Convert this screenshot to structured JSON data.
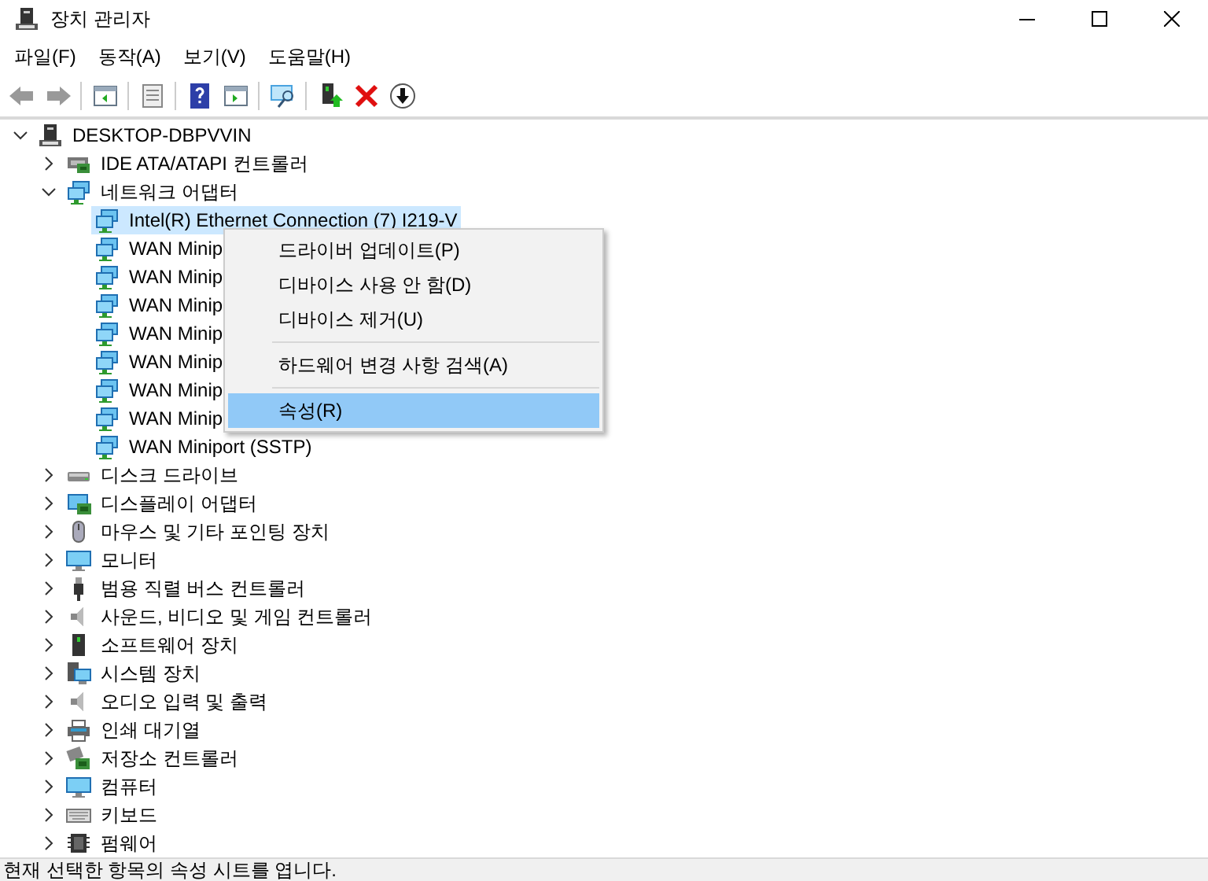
{
  "window": {
    "title": "장치 관리자"
  },
  "menu": [
    "파일(F)",
    "동작(A)",
    "보기(V)",
    "도움말(H)"
  ],
  "tree": {
    "label": "DESKTOP-DBPVVIN",
    "expanded": true,
    "selected": false,
    "children": [
      {
        "label": "IDE ATA/ATAPI 컨트롤러",
        "expanded": false,
        "selected": false
      },
      {
        "label": "네트워크 어댑터",
        "expanded": true,
        "selected": false,
        "children": [
          {
            "label": "Intel(R) Ethernet Connection (7) I219-V",
            "selected": true
          },
          {
            "label": "WAN Minip",
            "selected": false
          },
          {
            "label": "WAN Minip",
            "selected": false
          },
          {
            "label": "WAN Minip",
            "selected": false
          },
          {
            "label": "WAN Minip",
            "selected": false
          },
          {
            "label": "WAN Minip",
            "selected": false
          },
          {
            "label": "WAN Minip",
            "selected": false
          },
          {
            "label": "WAN Minip",
            "selected": false
          },
          {
            "label": "WAN Miniport (SSTP)",
            "selected": false
          }
        ]
      },
      {
        "label": "디스크 드라이브",
        "expanded": false,
        "selected": false
      },
      {
        "label": "디스플레이 어댑터",
        "expanded": false,
        "selected": false
      },
      {
        "label": "마우스 및 기타 포인팅 장치",
        "expanded": false,
        "selected": false
      },
      {
        "label": "모니터",
        "expanded": false,
        "selected": false
      },
      {
        "label": "범용 직렬 버스 컨트롤러",
        "expanded": false,
        "selected": false
      },
      {
        "label": "사운드, 비디오 및 게임 컨트롤러",
        "expanded": false,
        "selected": false
      },
      {
        "label": "소프트웨어 장치",
        "expanded": false,
        "selected": false
      },
      {
        "label": "시스템 장치",
        "expanded": false,
        "selected": false
      },
      {
        "label": "오디오 입력 및 출력",
        "expanded": false,
        "selected": false
      },
      {
        "label": "인쇄 대기열",
        "expanded": false,
        "selected": false
      },
      {
        "label": "저장소 컨트롤러",
        "expanded": false,
        "selected": false
      },
      {
        "label": "컴퓨터",
        "expanded": false,
        "selected": false
      },
      {
        "label": "키보드",
        "expanded": false,
        "selected": false
      },
      {
        "label": "펌웨어",
        "expanded": false,
        "selected": false
      }
    ]
  },
  "context_menu": [
    {
      "kind": "item",
      "label": "드라이버 업데이트(P)",
      "selected": false
    },
    {
      "kind": "item",
      "label": "디바이스 사용 안 함(D)",
      "selected": false
    },
    {
      "kind": "item",
      "label": "디바이스 제거(U)",
      "selected": false
    },
    {
      "kind": "separator"
    },
    {
      "kind": "item",
      "label": "하드웨어 변경 사항 검색(A)",
      "selected": false
    },
    {
      "kind": "separator"
    },
    {
      "kind": "item",
      "label": "속성(R)",
      "selected": true
    }
  ],
  "status_bar": "현재 선택한 항목의 속성 시트를 엽니다."
}
